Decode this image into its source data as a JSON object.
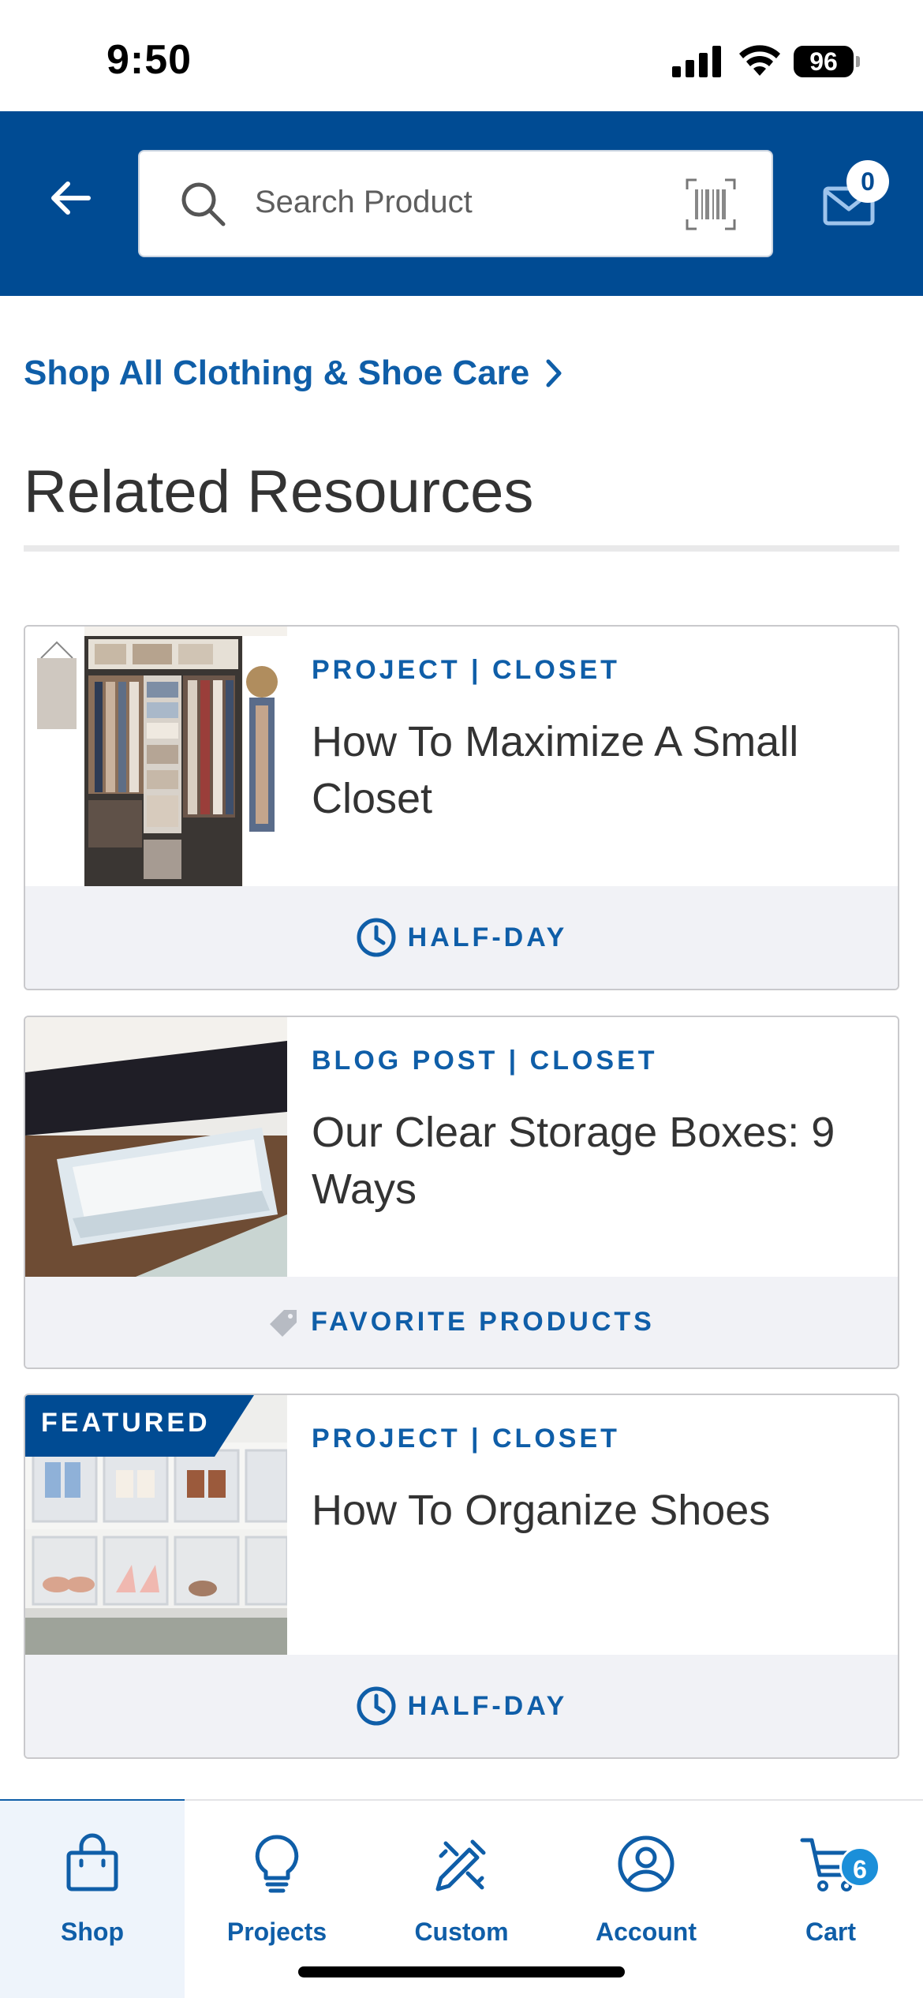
{
  "status_bar": {
    "time": "9:50",
    "battery": "96"
  },
  "header": {
    "search_placeholder": "Search Product",
    "mail_badge_count": "0",
    "background_color": "#004b93"
  },
  "shop_all_link": "Shop All Clothing & Shoe Care",
  "section_title": "Related Resources",
  "cards": [
    {
      "category": "PROJECT | CLOSET",
      "title": "How To Maximize A Small Closet",
      "footer": "HALF-DAY",
      "footer_icon": "clock-icon",
      "featured": ""
    },
    {
      "category": "BLOG POST | CLOSET",
      "title": "Our Clear Storage Boxes: 9 Ways",
      "footer": "FAVORITE PRODUCTS",
      "footer_icon": "tag-icon",
      "featured": ""
    },
    {
      "category": "PROJECT | CLOSET",
      "title": "How To Organize Shoes",
      "footer": "HALF-DAY",
      "footer_icon": "clock-icon",
      "featured": "FEATURED"
    }
  ],
  "tab_bar": {
    "active": "Shop",
    "tabs": [
      {
        "label": "Shop",
        "icon": "shopping-bag-icon"
      },
      {
        "label": "Projects",
        "icon": "lightbulb-icon"
      },
      {
        "label": "Custom",
        "icon": "pencil-ruler-icon"
      },
      {
        "label": "Account",
        "icon": "user-icon"
      },
      {
        "label": "Cart",
        "icon": "cart-icon",
        "badge": "6"
      }
    ]
  },
  "colors": {
    "brand_blue": "#004b93",
    "link_blue": "#0f5ea8",
    "badge_blue": "#1b8fd9"
  }
}
